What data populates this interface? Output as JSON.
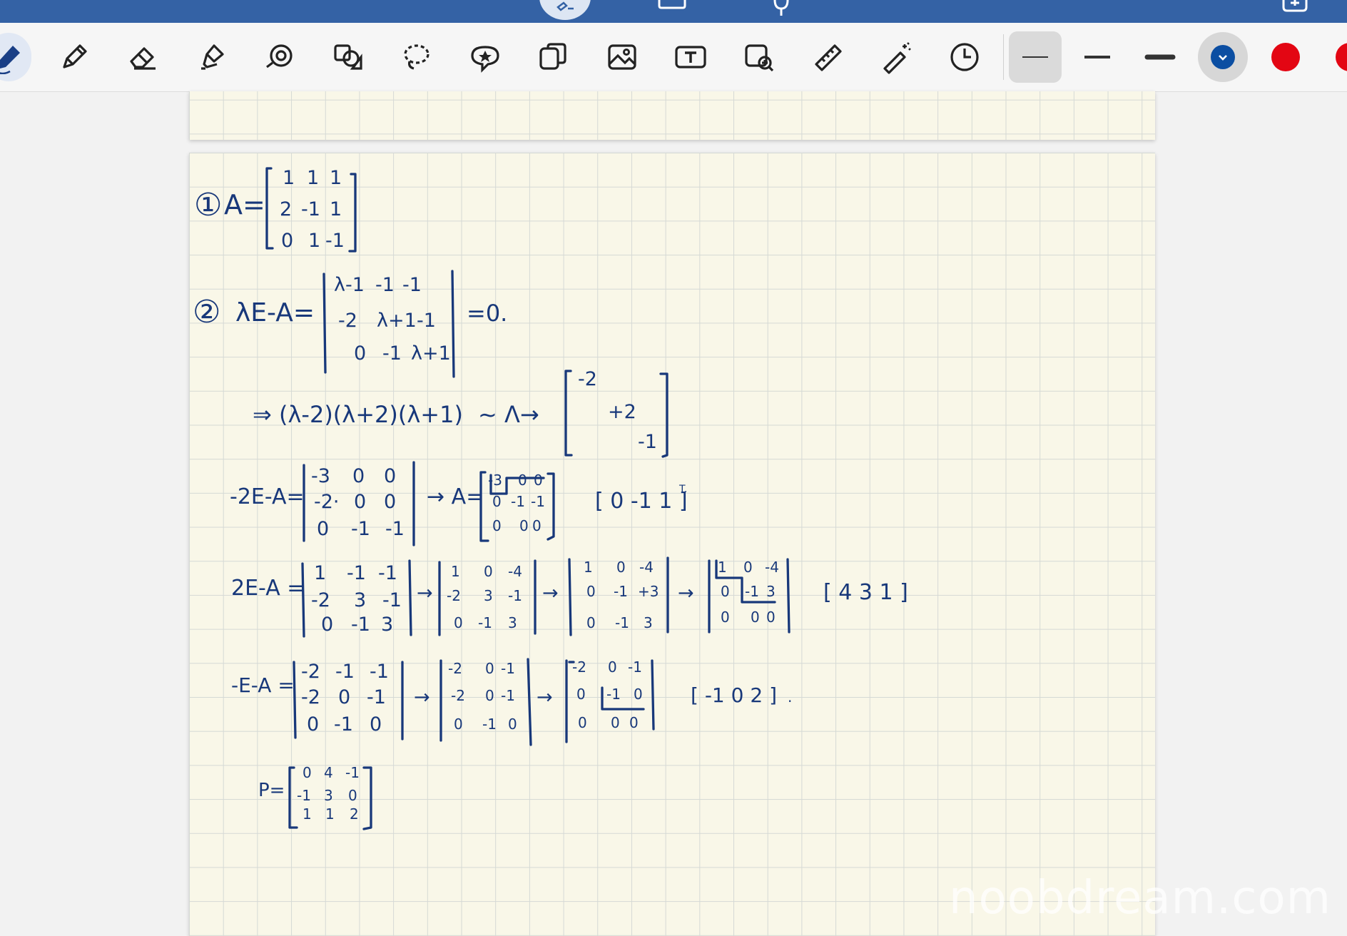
{
  "app": {
    "accent_color": "#3462a5",
    "ink_color": "#18387a",
    "paper_color": "#f9f7e8",
    "grid_color": "#d5d9d5"
  },
  "toolbar": {
    "tools": [
      {
        "name": "pen-tool",
        "icon": "pen-icon",
        "selected": true
      },
      {
        "name": "pencil-tool",
        "icon": "pencil-icon"
      },
      {
        "name": "eraser-tool",
        "icon": "eraser-icon"
      },
      {
        "name": "highlighter-tool",
        "icon": "highlighter-icon"
      },
      {
        "name": "laser-pointer-tool",
        "icon": "laser-icon"
      },
      {
        "name": "shapes-tool",
        "icon": "shapes-icon"
      },
      {
        "name": "lasso-tool",
        "icon": "lasso-icon"
      },
      {
        "name": "sticker-tool",
        "icon": "sticker-icon"
      },
      {
        "name": "copy-tool",
        "icon": "copy-icon"
      },
      {
        "name": "image-tool",
        "icon": "image-icon"
      },
      {
        "name": "text-tool",
        "icon": "text-icon"
      },
      {
        "name": "image-search-tool",
        "icon": "image-search-icon"
      },
      {
        "name": "ruler-tool",
        "icon": "ruler-icon"
      },
      {
        "name": "magic-wand-tool",
        "icon": "magic-wand-icon"
      },
      {
        "name": "history-tool",
        "icon": "clock-icon"
      }
    ],
    "stroke_widths": [
      "thin",
      "medium",
      "thick"
    ],
    "selected_stroke": "thin",
    "colors": [
      "#0b4ea2",
      "#e30613",
      "#e30613"
    ],
    "selected_color": "#0b4ea2"
  },
  "notes": {
    "step1_label": "①",
    "step1_matrix_lhs": "A=",
    "step1_matrix": [
      [
        "1",
        "1",
        "1"
      ],
      [
        "2",
        "-1",
        "1"
      ],
      [
        "0",
        "1",
        "-1"
      ]
    ],
    "step2_label": "②",
    "step2_lhs": "λE-A=",
    "step2_det": [
      [
        "λ-1",
        "-1",
        "-1"
      ],
      [
        "-2",
        "λ+1",
        "-1"
      ],
      [
        "0",
        "-1",
        "λ+1"
      ]
    ],
    "step2_rhs": "=0.",
    "step3_factor": "⇒ (λ-2)(λ+2)(λ+1)",
    "step3_tilde": "~ Λ→",
    "step3_diag": [
      "-2",
      "+2",
      "-1"
    ],
    "row4_lhs": "-2E-A=",
    "row4_mat": [
      [
        "-3",
        "0",
        "0"
      ],
      [
        "-2·",
        "0",
        "0"
      ],
      [
        "0",
        "-1",
        "-1"
      ]
    ],
    "row4_arrow": "→ A=",
    "row4_reduced": [
      [
        "-3",
        "0",
        "0"
      ],
      [
        "0",
        "-1",
        "-1"
      ],
      [
        "0",
        "0",
        "0"
      ]
    ],
    "row4_vector": "[ 0 -1 1 ]",
    "row4_vector_sup": "T.",
    "row5_lhs": "2E-A =",
    "row5_m1": [
      [
        "1",
        "-1",
        "-1"
      ],
      [
        "-2",
        "3",
        "-1"
      ],
      [
        "0",
        "-1",
        "3"
      ]
    ],
    "row5_m2": [
      [
        "1",
        "0",
        "-4"
      ],
      [
        "-2",
        "3",
        "-1"
      ],
      [
        "0",
        "-1",
        "3"
      ]
    ],
    "row5_m3": [
      [
        "1",
        "0",
        "-4"
      ],
      [
        "0",
        "-1",
        "+3"
      ],
      [
        "0",
        "-1",
        "3"
      ]
    ],
    "row5_m4": [
      [
        "1",
        "0",
        "-4"
      ],
      [
        "0",
        "-1",
        "3"
      ],
      [
        "0",
        "0",
        "0"
      ]
    ],
    "row5_vector": "[ 4 3 1 ]",
    "row6_lhs": "-E-A =",
    "row6_m1": [
      [
        "-2",
        "-1",
        "-1"
      ],
      [
        "-2",
        "0",
        "-1"
      ],
      [
        "0",
        "-1",
        "0"
      ]
    ],
    "row6_m2": [
      [
        "-2",
        "0",
        "-1"
      ],
      [
        "-2",
        "0",
        "-1"
      ],
      [
        "0",
        "-1",
        "0"
      ]
    ],
    "row6_m3": [
      [
        "-2",
        "0",
        "-1"
      ],
      [
        "0",
        "-1",
        "0"
      ],
      [
        "0",
        "0",
        "0"
      ]
    ],
    "row6_vector": "[ -1 0 2 ]",
    "row6_vector_end": ".",
    "p_lhs": "P=",
    "p_matrix": [
      [
        "0",
        "4",
        "-1"
      ],
      [
        "-1",
        "3",
        "0"
      ],
      [
        "1",
        "1",
        "2"
      ]
    ],
    "arrow": "→"
  },
  "watermark": "noobdream.com"
}
